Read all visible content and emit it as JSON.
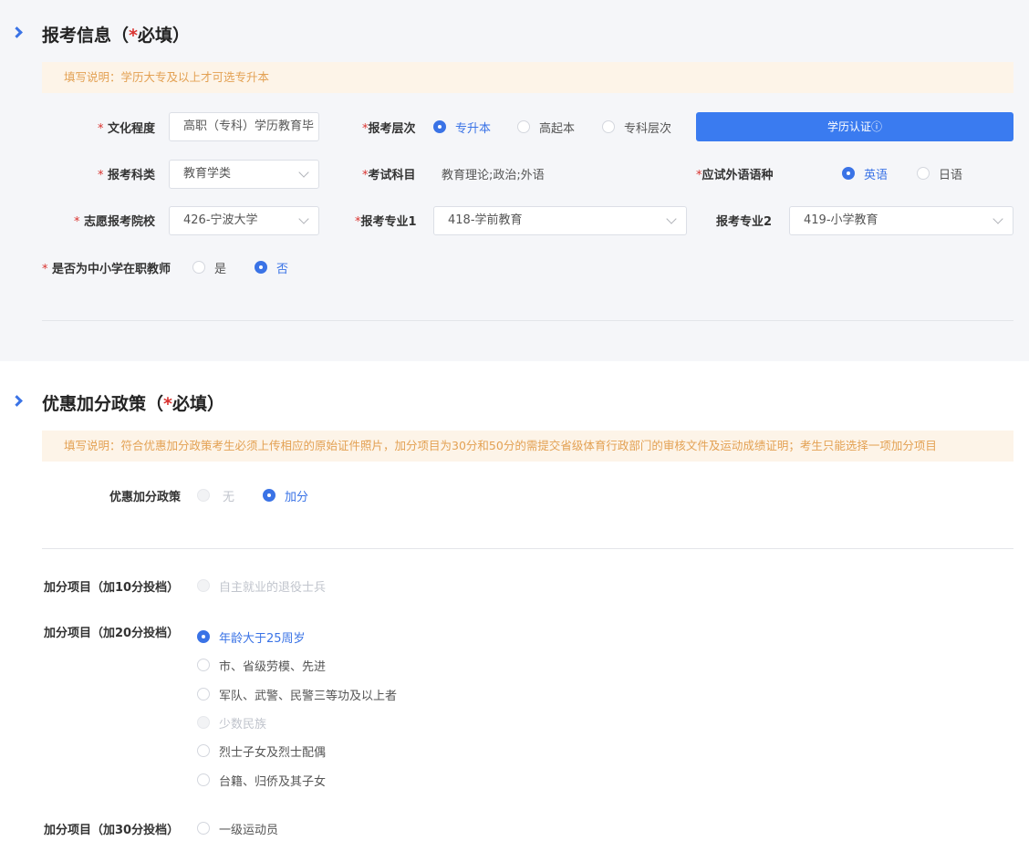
{
  "section1": {
    "title_prefix": "报考信息（",
    "title_star": "*",
    "title_suffix": "必填）",
    "notice": "填写说明：学历大专及以上才可选专升本",
    "education_label": "文化程度",
    "education_value": "高职（专科）学历教育毕",
    "level_label": "报考层次",
    "level_options": [
      "专升本",
      "高起本",
      "专科层次"
    ],
    "verify_button": "学历认证ⓘ",
    "subject_label": "报考科类",
    "subject_value": "教育学类",
    "exam_label": "考试科目",
    "exam_value": "教育理论;政治;外语",
    "language_label": "应试外语语种",
    "language_options": [
      "英语",
      "日语"
    ],
    "school_label": "志愿报考院校",
    "school_value": "426-宁波大学",
    "major1_label": "报考专业1",
    "major1_value": "418-学前教育",
    "major2_label": "报考专业2",
    "major2_value": "419-小学教育",
    "teacher_label": "是否为中小学在职教师",
    "teacher_options": [
      "是",
      "否"
    ],
    "star": "*"
  },
  "section2": {
    "title_prefix": "优惠加分政策（",
    "title_star": "*",
    "title_suffix": "必填）",
    "notice": "填写说明：符合优惠加分政策考生必须上传相应的原始证件照片，加分项目为30分和50分的需提交省级体育行政部门的审核文件及运动成绩证明；考生只能选择一项加分项目",
    "policy_label": "优惠加分政策",
    "policy_options": [
      "无",
      "加分"
    ],
    "group10_label": "加分项目（加10分投档）",
    "group10_options": [
      "自主就业的退役士兵"
    ],
    "group20_label": "加分项目（加20分投档）",
    "group20_options": [
      "年龄大于25周岁",
      "市、省级劳模、先进",
      "军队、武警、民警三等功及以上者",
      "少数民族",
      "烈士子女及烈士配偶",
      "台籍、归侨及其子女"
    ],
    "group30_label": "加分项目（加30分投档）",
    "group30_options": [
      "一级运动员"
    ]
  },
  "colors": {
    "accent": "#3a73e6",
    "required": "#d9322f",
    "notice_text": "#e3a153",
    "notice_bg": "#fdf4e8"
  }
}
